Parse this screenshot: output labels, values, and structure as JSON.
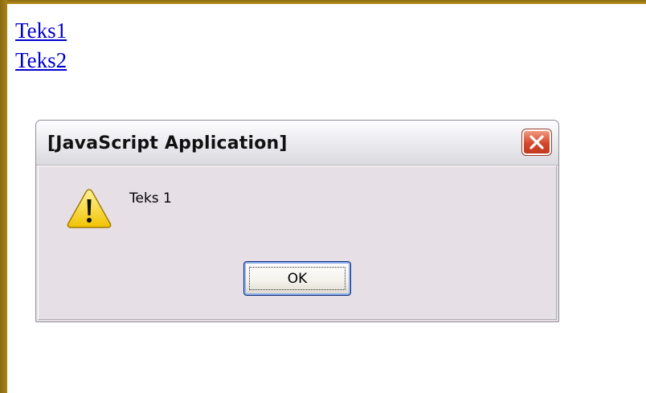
{
  "page": {
    "links": [
      {
        "label": "Teks1"
      },
      {
        "label": "Teks2"
      }
    ],
    "link_color": "#0000cc",
    "frame_color": "#a07a14"
  },
  "dialog": {
    "title": "[JavaScript Application]",
    "message": "Teks 1",
    "ok_label": "OK",
    "icon": "warning-icon",
    "close_icon": "close-icon",
    "close_button_color": "#d4492d",
    "background_color": "#e7dfe6"
  }
}
